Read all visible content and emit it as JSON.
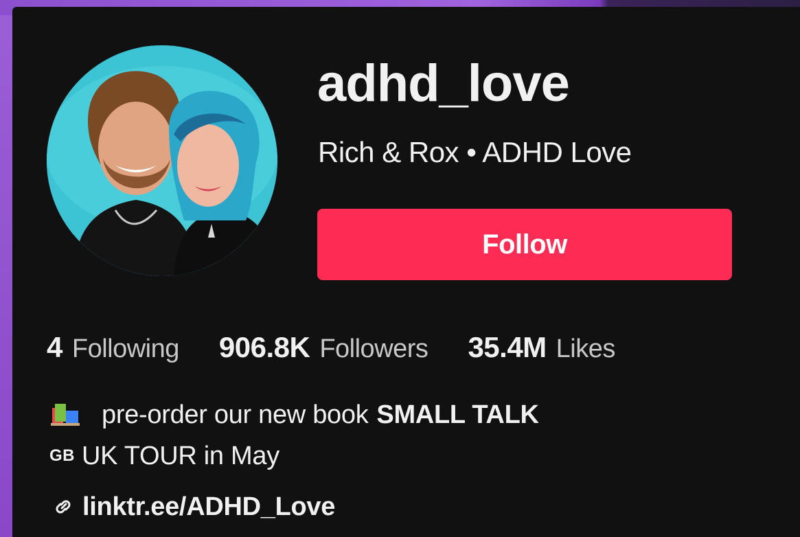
{
  "profile": {
    "username": "adhd_love",
    "nickname": "Rich & Rox • ADHD Love",
    "follow_label": "Follow"
  },
  "stats": [
    {
      "value": "4",
      "label": "Following"
    },
    {
      "value": "906.8K",
      "label": "Followers"
    },
    {
      "value": "35.4M",
      "label": "Likes"
    }
  ],
  "bio": {
    "line1_icon": "books-icon",
    "line1_text": "pre-order our new book",
    "line1_bold": "SMALL TALK",
    "line2_flag": "GB",
    "line2_text": "UK TOUR in May"
  },
  "link": {
    "icon": "link-icon",
    "text": "linktr.ee/ADHD_Love"
  },
  "colors": {
    "follow_bg": "#fe2c55",
    "panel_bg": "#111111",
    "text_primary": "#f1f1f2",
    "backdrop": "#8f52cf"
  }
}
